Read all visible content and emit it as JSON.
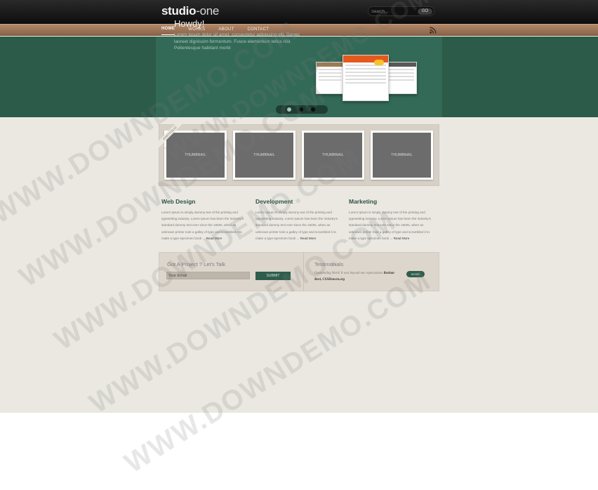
{
  "header": {
    "logo_bold": "studio",
    "logo_light": "-one",
    "search_placeholder": "Search...",
    "search_button": "GO"
  },
  "nav": {
    "items": [
      {
        "label": "HOME",
        "active": true
      },
      {
        "label": "WORKS",
        "active": false
      },
      {
        "label": "ABOUT",
        "active": false
      },
      {
        "label": "CONTACT",
        "active": false
      }
    ],
    "rss_icon": "rss-icon"
  },
  "hero": {
    "title": "Howdy!",
    "text": "Lorem ipsum dolor sit amet, consectetur adipiscing elit. Donec laoreet dignissim fermentum. Fusce elementum tellus nisl. Pellentesque habitant morbi",
    "slider_dots": 3,
    "active_dot": 1
  },
  "portfolio": {
    "ribbon": "PORTFOLIO",
    "thumbnails": [
      "THUMBNAIL",
      "THUMBNAIL",
      "THUMBNAIL",
      "THUMBNAIL"
    ]
  },
  "columns": [
    {
      "title": "Web Design",
      "text": "Lorem Ipsum is simply dummy text of the printing and typesetting industry. Lorem Ipsum has been the industry's standard dummy text ever since the 1500s, when an unknown printer took a galley of type and scrambled it to make a type specimen book ...",
      "readmore": "Read More"
    },
    {
      "title": "Development",
      "text": "Lorem Ipsum is simply dummy text of the printing and typesetting industry. Lorem Ipsum has been the industry's standard dummy text ever since the 1500s, when an unknown printer took a galley of type and scrambled it to make a type specimen book ...",
      "readmore": "Read More"
    },
    {
      "title": "Marketing",
      "text": "Lorem Ipsum is simply dummy text of the printing and typesetting industry. Lorem Ipsum has been the industry's standard dummy text ever since the 1500s, when an unknown printer took a galley of type and scrambled it to make a type specimen book ...",
      "readmore": "Read More"
    }
  ],
  "contact": {
    "title": "Got A Project ? Let's Talk",
    "email_placeholder": "Your Email",
    "submit": "SUBMIT"
  },
  "testimonials": {
    "title": "Testimonials",
    "quote": "Outstanding Work! It was beyond our expectations",
    "author": "Roshan Ravi, CSSHeaven.org",
    "more": "MORE"
  },
  "watermark": "WWW.DOWNDEMO.COM",
  "colors": {
    "accent_green": "#2e5d4c",
    "hero_bg": "#2c5b4a",
    "nav_brown": "#9c7458",
    "page_bg": "#ebe8e2"
  }
}
